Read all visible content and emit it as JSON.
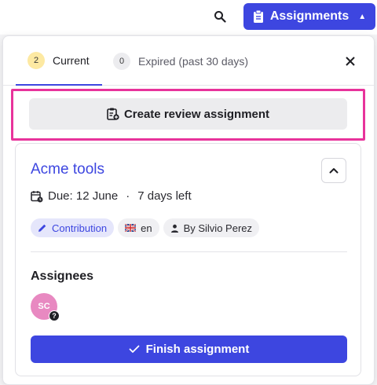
{
  "topbar": {
    "search_icon": "search-icon",
    "assignments_label": "Assignments",
    "assignments_icon": "clipboard-icon"
  },
  "tabs": {
    "current": {
      "count": "2",
      "label": "Current"
    },
    "expired": {
      "count": "0",
      "label": "Expired (past 30 days)"
    }
  },
  "actions": {
    "create_label": "Create review assignment"
  },
  "assignment": {
    "title": "Acme tools",
    "due": "Due: 12 June",
    "separator": "·",
    "time_left": "7 days left",
    "tags": {
      "type": "Contribution",
      "language": "en",
      "author": "By Silvio Perez"
    },
    "assignees_label": "Assignees",
    "assignee_initials": "SC",
    "assignee_status": "?",
    "finish_label": "Finish assignment"
  },
  "colors": {
    "accent": "#3d46e0",
    "highlight": "#e8339b",
    "current_badge": "#fde9a2",
    "avatar": "#e889c1"
  }
}
